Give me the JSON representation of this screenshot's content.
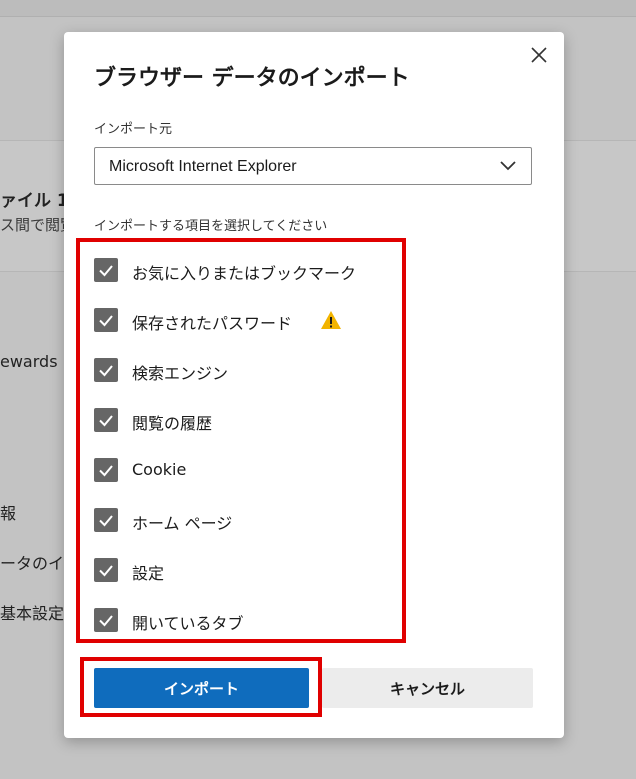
{
  "background": {
    "profile_title": "ァイル 1",
    "profile_subtitle": "ス間で閲覧",
    "rewards": "ewards",
    "item4": "報",
    "import_link": "ータのインポ",
    "default_settings": "基本設定"
  },
  "dialog": {
    "title": "ブラウザー データのインポート",
    "close_icon": "close-icon",
    "source_label": "インポート元",
    "source_value": "Microsoft Internet Explorer",
    "items_label": "インポートする項目を選択してください",
    "items": [
      {
        "label": "お気に入りまたはブックマーク",
        "checked": true
      },
      {
        "label": "保存されたパスワード",
        "checked": true,
        "warning": true
      },
      {
        "label": "検索エンジン",
        "checked": true
      },
      {
        "label": "閲覧の履歴",
        "checked": true
      },
      {
        "label": "Cookie",
        "checked": true
      },
      {
        "label": "ホーム ページ",
        "checked": true
      },
      {
        "label": "設定",
        "checked": true
      },
      {
        "label": "開いているタブ",
        "checked": true
      }
    ],
    "import_label": "インポート",
    "cancel_label": "キャンセル"
  },
  "colors": {
    "accent": "#0f6cbd",
    "highlight": "#e00000",
    "warning": "#f2b400",
    "checkbox": "#666666"
  }
}
